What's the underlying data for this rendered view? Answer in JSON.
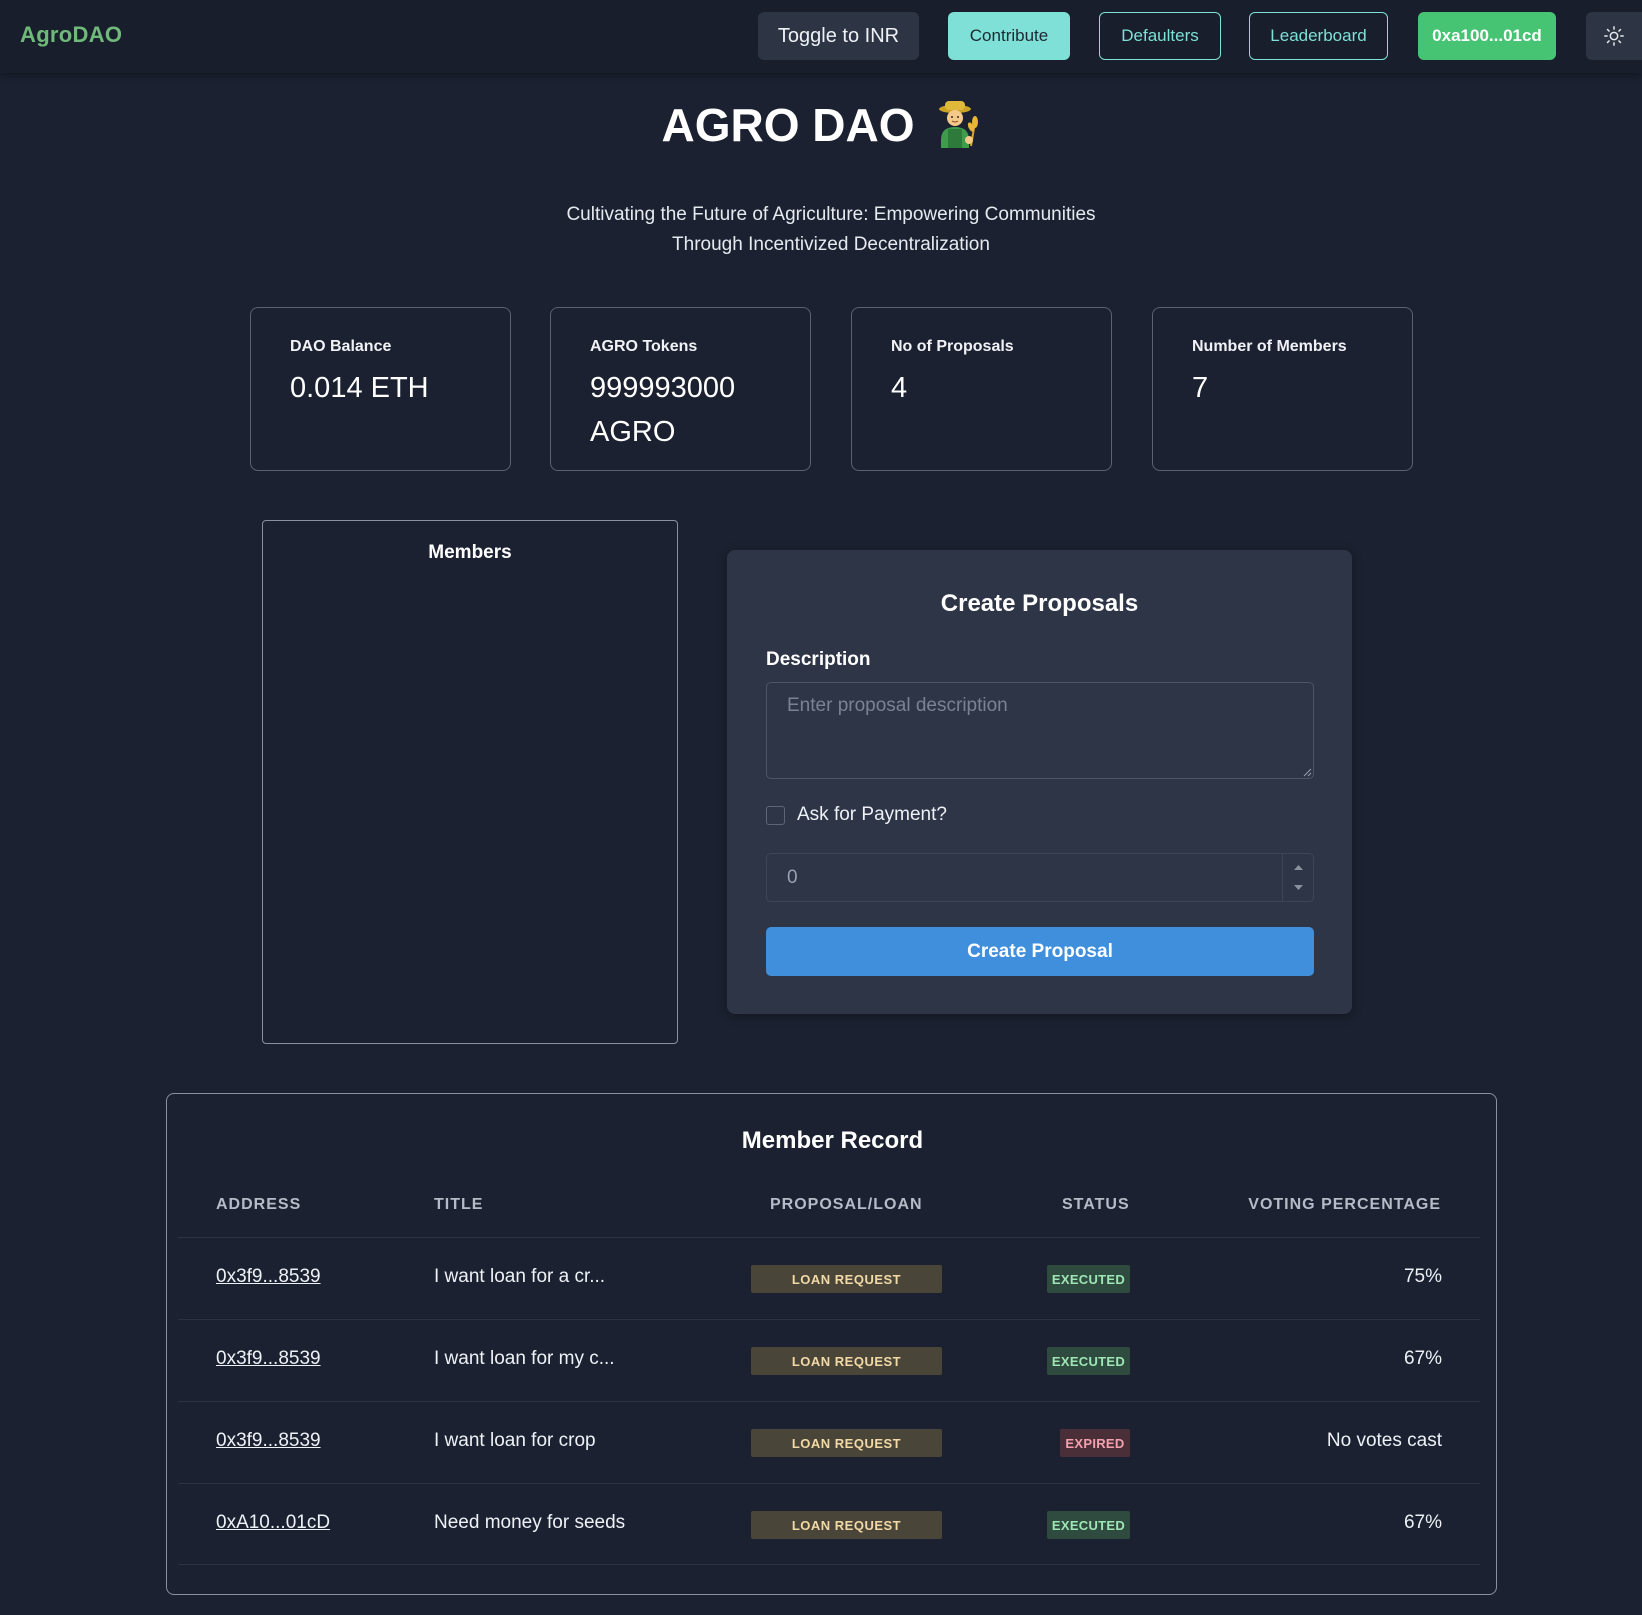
{
  "navbar": {
    "brand": "AgroDAO",
    "toggle_label": "Toggle to INR",
    "contribute_label": "Contribute",
    "defaulters_label": "Defaulters",
    "leaderboard_label": "Leaderboard",
    "wallet_label": "0xa100...01cd",
    "theme_icon": "sun-icon"
  },
  "hero": {
    "title": "AGRO DAO",
    "title_icon": "farmer-emoji",
    "subtitle_line1": "Cultivating the Future of Agriculture: Empowering Communities",
    "subtitle_line2": "Through Incentivized Decentralization"
  },
  "stats": [
    {
      "label": "DAO Balance",
      "value": "0.014 ETH"
    },
    {
      "label": "AGRO Tokens",
      "value": "999993000 AGRO"
    },
    {
      "label": "No of Proposals",
      "value": "4"
    },
    {
      "label": "Number of Members",
      "value": "7"
    }
  ],
  "members": {
    "title": "Members"
  },
  "create_proposal": {
    "title": "Create Proposals",
    "description_label": "Description",
    "description_placeholder": "Enter proposal description",
    "payment_label": "Ask for Payment?",
    "payment_checked": false,
    "amount_value": "0",
    "submit_label": "Create Proposal"
  },
  "member_record": {
    "title": "Member Record",
    "headers": [
      "ADDRESS",
      "TITLE",
      "PROPOSAL/LOAN",
      "STATUS",
      "VOTING PERCENTAGE"
    ],
    "rows": [
      {
        "address": "0x3f9...8539",
        "title": "I want loan for a cr...",
        "type": "LOAN REQUEST",
        "status": "EXECUTED",
        "voting": "75%"
      },
      {
        "address": "0x3f9...8539",
        "title": "I want loan for my c...",
        "type": "LOAN REQUEST",
        "status": "EXECUTED",
        "voting": "67%"
      },
      {
        "address": "0x3f9...8539",
        "title": "I want loan for crop",
        "type": "LOAN REQUEST",
        "status": "EXPIRED",
        "voting": "No votes cast"
      },
      {
        "address": "0xA10...01cD",
        "title": "Need money for seeds",
        "type": "LOAN REQUEST",
        "status": "EXECUTED",
        "voting": "67%"
      }
    ]
  },
  "colors": {
    "background": "#1b2130",
    "brand_green": "#6fba7a",
    "accent_teal": "#7ee0d6",
    "wallet_green": "#47c374",
    "primary_blue": "#3f8fdc"
  }
}
